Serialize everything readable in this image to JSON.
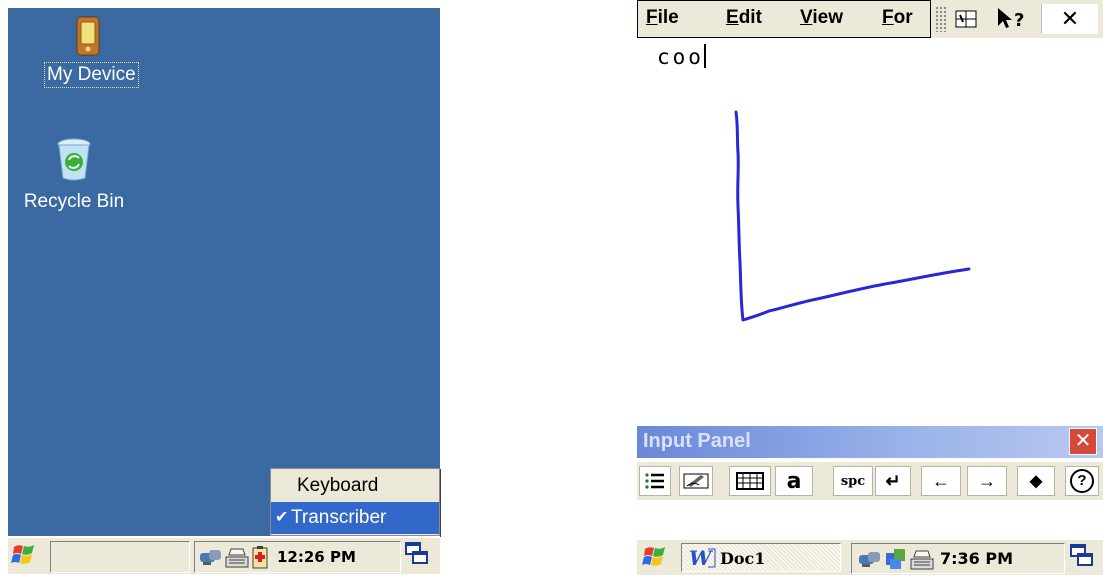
{
  "left": {
    "desktop": {
      "color": "#3a6aa1",
      "icons": [
        {
          "label": "My Device",
          "icon": "pda-device-icon"
        },
        {
          "label": "Recycle Bin",
          "icon": "recycle-bin-icon"
        }
      ]
    },
    "input_menu": {
      "items": [
        {
          "label": "Keyboard",
          "checked": false
        },
        {
          "label": "Transcriber",
          "checked": true
        }
      ],
      "highlight_color": "#3268c8"
    },
    "taskbar": {
      "start_icon": "windows-flag-icon",
      "tray_icons": [
        "network-icon",
        "keyboard-input-icon",
        "battery-icon"
      ],
      "time": "12:26 PM",
      "desktop_icon": "show-desktop-icon"
    }
  },
  "right": {
    "menubar": {
      "menus": [
        "File",
        "Edit",
        "View",
        "For"
      ],
      "tools": [
        "input-panel-icon",
        "whats-this-help-icon",
        "close-icon"
      ]
    },
    "document": {
      "text": "coo",
      "ink_stroke": "handwritten-L-stroke",
      "ink_color": "#2828d8"
    },
    "input_panel": {
      "title": "Input Panel",
      "keys": [
        {
          "icon": "options-menu-icon"
        },
        {
          "icon": "pen-icon"
        },
        {
          "icon": "keyboard-grid-icon"
        },
        {
          "label": "a"
        },
        {
          "label": "spc"
        },
        {
          "label": "↵"
        },
        {
          "label": "←"
        },
        {
          "label": "→"
        },
        {
          "label": "◆"
        },
        {
          "label": "?"
        }
      ]
    },
    "taskbar": {
      "start_icon": "windows-flag-icon",
      "task": "Doc1",
      "task_icon": "word-doc-icon",
      "tray_icons": [
        "network-icon",
        "sync-icon",
        "keyboard-input-icon"
      ],
      "time": "7:36 PM",
      "desktop_icon": "show-desktop-icon"
    }
  }
}
